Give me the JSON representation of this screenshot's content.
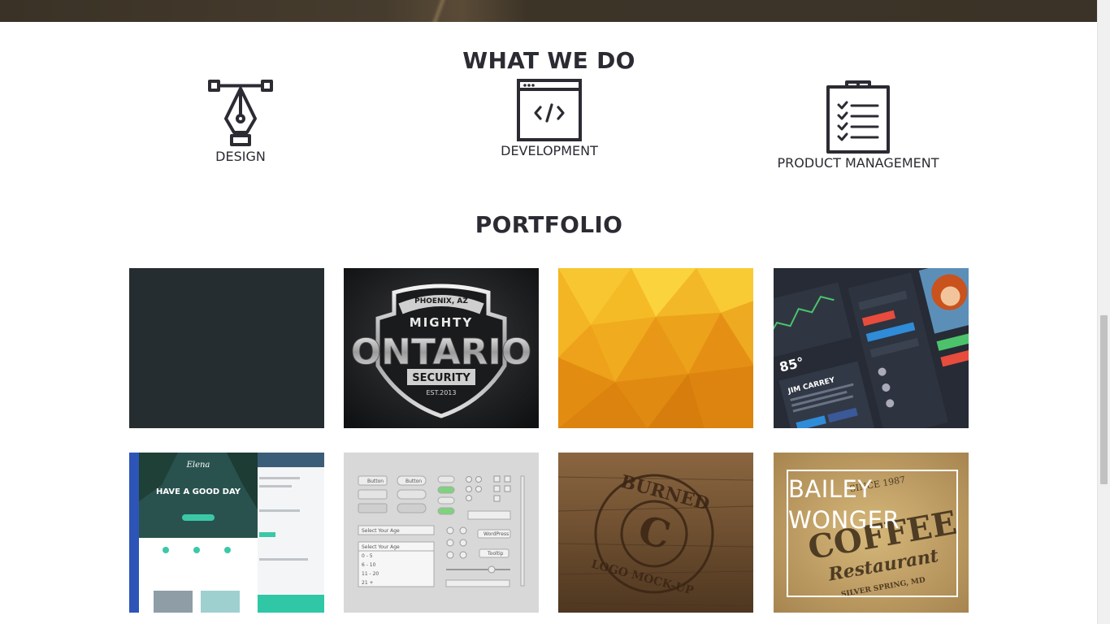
{
  "sections": {
    "services_title": "WHAT WE DO",
    "portfolio_title": "PORTFOLIO"
  },
  "services": [
    {
      "label": "DESIGN",
      "icon": "pen-tool-icon"
    },
    {
      "label": "DEVELOPMENT",
      "icon": "code-window-icon"
    },
    {
      "label": "PRODUCT MANAGEMENT",
      "icon": "clipboard-checklist-icon"
    }
  ],
  "portfolio": {
    "items": [
      {
        "name": "dark-placeholder",
        "color": "#262d30"
      },
      {
        "name": "mighty-ontario-logo",
        "texts": {
          "top": "PHOENIX, AZ",
          "brand_top": "MIGHTY",
          "brand": "ONTARIO",
          "sub": "SECURITY",
          "est": "EST.2013"
        }
      },
      {
        "name": "yellow-polygon-background",
        "color": "#f0a81c"
      },
      {
        "name": "dark-ui-kit",
        "texts": {
          "temp": "85°",
          "name": "JIM CARREY"
        }
      },
      {
        "name": "elena-website",
        "texts": {
          "brand": "Elena",
          "headline": "HAVE A GOOD DAY"
        }
      },
      {
        "name": "light-ui-kit",
        "texts": {
          "button": "Button",
          "select": "Select Your Age",
          "wp": "WordPress",
          "tooltip": "Tooltip",
          "opt1": "0 - 5",
          "opt2": "6 - 10",
          "opt3": "11 - 20",
          "opt4": "21 +"
        }
      },
      {
        "name": "burned-logo-mockup",
        "texts": {
          "top": "BURNED",
          "bottom": "LOGO MOCK-UP",
          "letter": "C"
        }
      },
      {
        "name": "bailey-wonger",
        "title": "BAILEY WONGER",
        "texts": {
          "coffee": "COFFEE",
          "restaurant": "Restaurant",
          "city": "SILVER SPRING, MD",
          "since": "SINCE 1987"
        }
      }
    ]
  },
  "colors": {
    "text": "#2b2b33",
    "hero": "#3b3327",
    "scrollbar": "#c1c1c1"
  }
}
